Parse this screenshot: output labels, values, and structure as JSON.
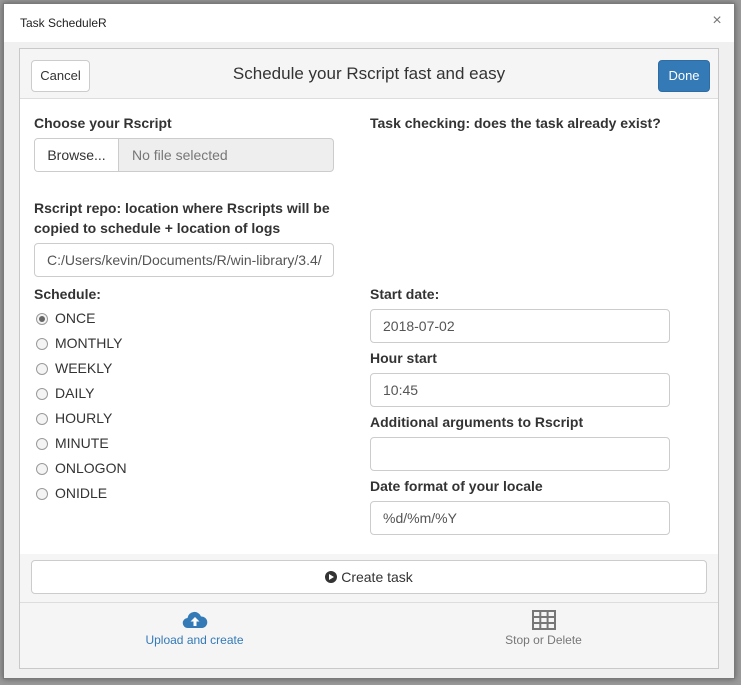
{
  "window": {
    "title": "Task ScheduleR",
    "close_glyph": "×"
  },
  "header": {
    "cancel_label": "Cancel",
    "title": "Schedule your Rscript fast and easy",
    "done_label": "Done"
  },
  "left": {
    "choose_label": "Choose your Rscript",
    "browse_label": "Browse...",
    "file_status": "No file selected",
    "repo_label_line1": "Rscript repo: location where Rscripts will be",
    "repo_label_line2": "copied to schedule + location of logs",
    "repo_value": "C:/Users/kevin/Documents/R/win-library/3.4/",
    "schedule_label": "Schedule:",
    "schedule_options": [
      "ONCE",
      "MONTHLY",
      "WEEKLY",
      "DAILY",
      "HOURLY",
      "MINUTE",
      "ONLOGON",
      "ONIDLE"
    ],
    "schedule_selected": "ONCE"
  },
  "right": {
    "task_checking_label": "Task checking: does the task already exist?",
    "start_date_label": "Start date:",
    "start_date_value": "2018-07-02",
    "hour_start_label": "Hour start",
    "hour_start_value": "10:45",
    "args_label": "Additional arguments to Rscript",
    "args_value": "",
    "date_format_label": "Date format of your locale",
    "date_format_value": "%d/%m/%Y"
  },
  "create_button": {
    "label": "Create task",
    "icon": "play-circle-icon"
  },
  "tabs": [
    {
      "label": "Upload and create",
      "icon": "cloud-upload-icon",
      "active": true,
      "color": "#337ab7"
    },
    {
      "label": "Stop or Delete",
      "icon": "table-icon",
      "active": false,
      "color": "#777777"
    }
  ]
}
